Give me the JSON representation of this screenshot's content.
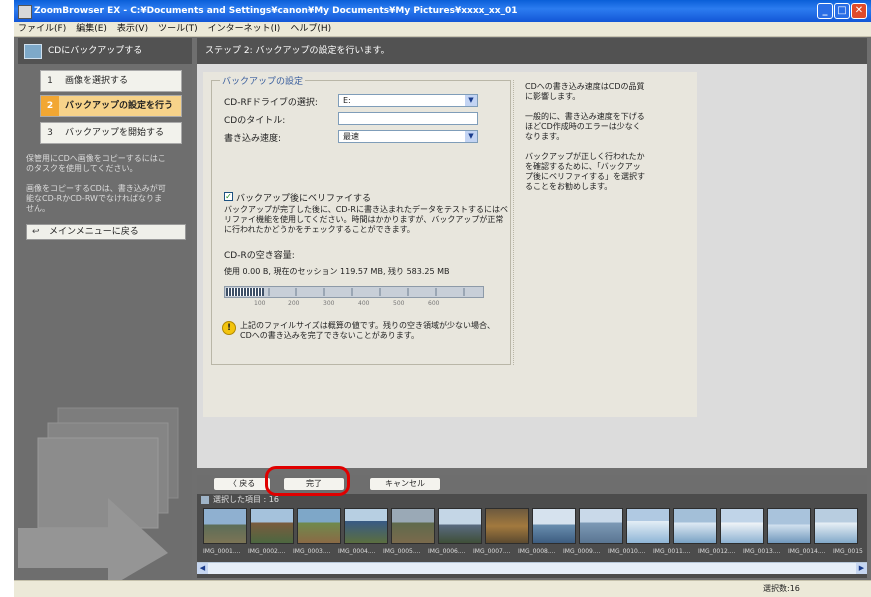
{
  "window": {
    "title": "ZoomBrowser EX  -  C:¥Documents and Settings¥canon¥My Documents¥My Pictures¥xxxx_xx_01"
  },
  "menu": [
    "ファイル(F)",
    "編集(E)",
    "表示(V)",
    "ツール(T)",
    "インターネット(I)",
    "ヘルプ(H)"
  ],
  "sidebar": {
    "title": "CDにバックアップする",
    "steps": [
      {
        "num": "1",
        "label": "画像を選択する"
      },
      {
        "num": "2",
        "label": "バックアップの設定を行う"
      },
      {
        "num": "3",
        "label": "バックアップを開始する"
      }
    ],
    "note1": "保管用にCDへ画像をコピーするにはこのタスクを使用してください。",
    "note2": "画像をコピーするCDは、書き込みが可能なCD-RかCD-RWでなければなりません。",
    "back_menu": "メインメニューに戻る"
  },
  "step_header": "ステップ 2: バックアップの設定を行います。",
  "settings": {
    "legend": "バックアップの設定",
    "drive_label": "CD-RFドライブの選択:",
    "drive_value": "E:",
    "title_label": "CDのタイトル:",
    "title_value": "",
    "speed_label": "書き込み速度:",
    "speed_value": "最速",
    "verify_label": "バックアップ後にベリファイする",
    "verify_checked": "✓",
    "verify_desc": "バックアップが完了した後に、CD-Rに書き込まれたデータをテストするにはベリファイ機能を使用してください。時間はかかりますが、バックアップが正常に行われたかどうかをチェックすることができます。",
    "free_label": "CD-Rの空き容量:",
    "usage_text": "使用 0.00 B, 現在のセッション 119.57 MB, 残り 583.25 MB",
    "usage_fraction": 0.15,
    "ticks": [
      "100",
      "200",
      "300",
      "400",
      "500",
      "600"
    ],
    "warn_icon": "!",
    "warning": "上記のファイルサイズは概算の値です。残りの空き領域が少ない場合、CDへの書き込みを完了できないことがあります。"
  },
  "help": {
    "h1": "CDへの書き込み速度はCDの品質に影響します。",
    "h2": "一般的に、書き込み速度を下げるほどCD作成時のエラーは少なくなります。",
    "h3": "バックアップが正しく行われたかを確認するために、「バックアップ後にベリファイする」を選択することをお勧めします。"
  },
  "buttons": {
    "back": "〈 戻る",
    "done": "完了",
    "cancel": "キャンセル"
  },
  "strip": {
    "header": "選択した項目 : 16",
    "files": [
      "IMG_0001....",
      "IMG_0002....",
      "IMG_0003....",
      "IMG_0004....",
      "IMG_0005....",
      "IMG_0006....",
      "IMG_0007....",
      "IMG_0008....",
      "IMG_0009....",
      "IMG_0010....",
      "IMG_0011....",
      "IMG_0012....",
      "IMG_0013....",
      "IMG_0014....",
      "IMG_0015"
    ]
  },
  "status": "選択数:16"
}
